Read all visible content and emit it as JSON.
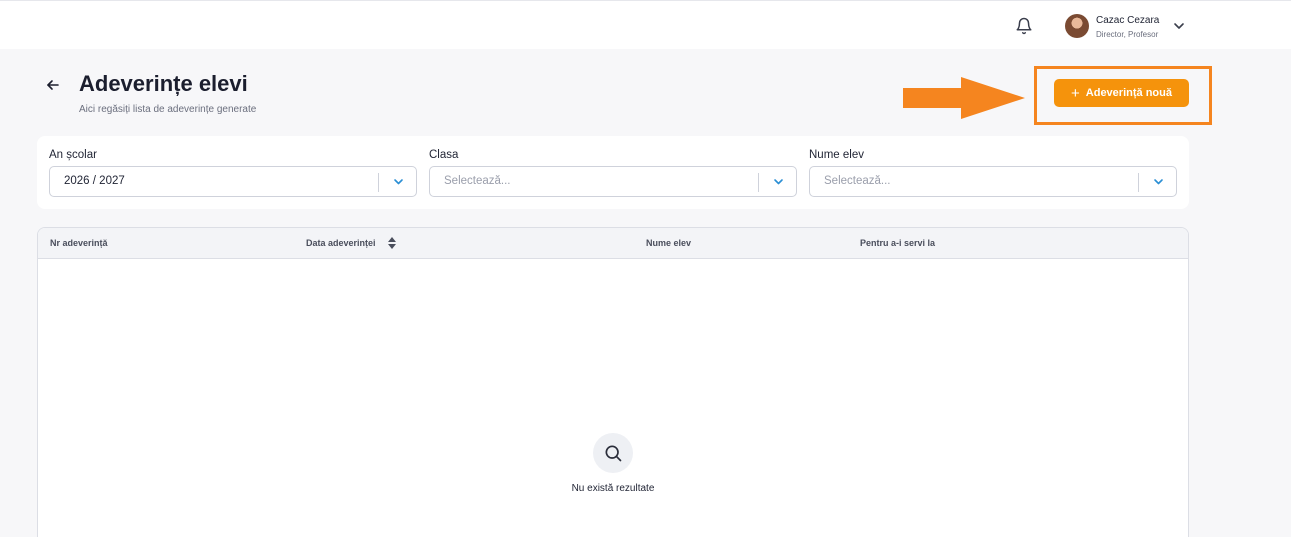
{
  "header": {
    "user_name": "Cazac Cezara",
    "user_role": "Director, Profesor"
  },
  "page": {
    "title": "Adeverințe elevi",
    "subtitle": "Aici regăsiți lista de adeverințe generate",
    "new_button_plus": "+",
    "new_button_label": "Adeverință nouă"
  },
  "filters": {
    "school_year": {
      "label": "An școlar",
      "value": "2026 / 2027"
    },
    "class": {
      "label": "Clasa",
      "placeholder": "Selectează..."
    },
    "student_name": {
      "label": "Nume elev",
      "placeholder": "Selectează..."
    }
  },
  "table": {
    "columns": [
      "Nr adeverință",
      "Data adeverinței",
      "Nume elev",
      "Pentru a-i servi la"
    ],
    "empty_message": "Nu există rezultate"
  },
  "colors": {
    "accent": "#f5930c",
    "annotation": "#f5851f",
    "background": "#f7f7f9"
  },
  "icons": [
    "bell-icon",
    "chevron-down-icon",
    "arrow-left-icon",
    "plus-icon",
    "sort-icon",
    "search-icon"
  ]
}
